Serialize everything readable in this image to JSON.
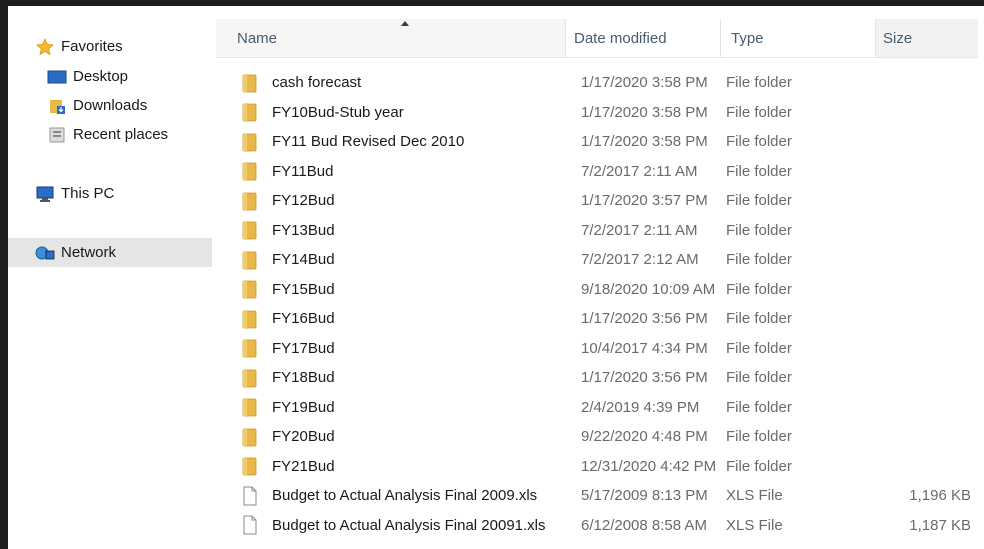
{
  "nav": {
    "favorites": "Favorites",
    "desktop": "Desktop",
    "downloads": "Downloads",
    "recent_places": "Recent places",
    "this_pc": "This PC",
    "network": "Network"
  },
  "columns": {
    "name": "Name",
    "date_modified": "Date modified",
    "type": "Type",
    "size": "Size"
  },
  "files": [
    {
      "name": "cash forecast",
      "date": "1/17/2020 3:58 PM",
      "type": "File folder",
      "size": "",
      "icon": "folder-icon"
    },
    {
      "name": "FY10Bud-Stub year",
      "date": "1/17/2020 3:58 PM",
      "type": "File folder",
      "size": "",
      "icon": "folder-icon"
    },
    {
      "name": "FY11 Bud Revised Dec 2010",
      "date": "1/17/2020 3:58 PM",
      "type": "File folder",
      "size": "",
      "icon": "folder-icon"
    },
    {
      "name": "FY11Bud",
      "date": "7/2/2017 2:11 AM",
      "type": "File folder",
      "size": "",
      "icon": "folder-icon"
    },
    {
      "name": "FY12Bud",
      "date": "1/17/2020 3:57 PM",
      "type": "File folder",
      "size": "",
      "icon": "folder-icon"
    },
    {
      "name": "FY13Bud",
      "date": "7/2/2017 2:11 AM",
      "type": "File folder",
      "size": "",
      "icon": "folder-icon"
    },
    {
      "name": "FY14Bud",
      "date": "7/2/2017 2:12 AM",
      "type": "File folder",
      "size": "",
      "icon": "folder-icon"
    },
    {
      "name": "FY15Bud",
      "date": "9/18/2020 10:09 AM",
      "type": "File folder",
      "size": "",
      "icon": "folder-icon"
    },
    {
      "name": "FY16Bud",
      "date": "1/17/2020 3:56 PM",
      "type": "File folder",
      "size": "",
      "icon": "folder-icon"
    },
    {
      "name": "FY17Bud",
      "date": "10/4/2017 4:34 PM",
      "type": "File folder",
      "size": "",
      "icon": "folder-icon"
    },
    {
      "name": "FY18Bud",
      "date": "1/17/2020 3:56 PM",
      "type": "File folder",
      "size": "",
      "icon": "folder-icon"
    },
    {
      "name": "FY19Bud",
      "date": "2/4/2019 4:39 PM",
      "type": "File folder",
      "size": "",
      "icon": "folder-icon"
    },
    {
      "name": "FY20Bud",
      "date": "9/22/2020 4:48 PM",
      "type": "File folder",
      "size": "",
      "icon": "folder-icon"
    },
    {
      "name": "FY21Bud",
      "date": "12/31/2020 4:42 PM",
      "type": "File folder",
      "size": "",
      "icon": "folder-icon"
    },
    {
      "name": "Budget to Actual Analysis Final 2009.xls",
      "date": "5/17/2009 8:13 PM",
      "type": "XLS File",
      "size": "1,196 KB",
      "icon": "file-icon"
    },
    {
      "name": "Budget to Actual Analysis Final 20091.xls",
      "date": "6/12/2008 8:58 AM",
      "type": "XLS File",
      "size": "1,187 KB",
      "icon": "file-icon"
    }
  ],
  "colors": {
    "folder": "#e8b84a",
    "selected_nav": "#e5e5e5",
    "header_text": "#4a5a70",
    "frame": "#1e1e1e"
  }
}
